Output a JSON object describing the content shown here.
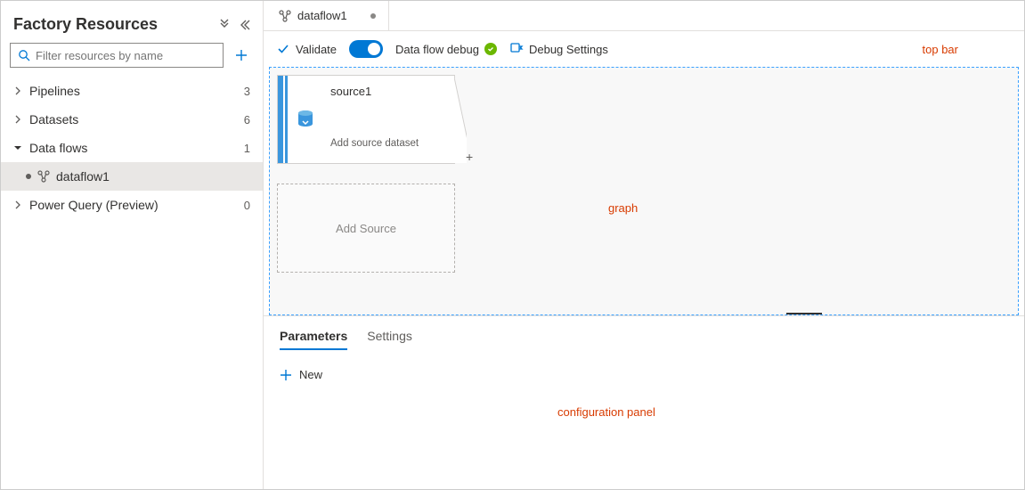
{
  "sidebar": {
    "title": "Factory Resources",
    "filter_placeholder": "Filter resources by name",
    "items": [
      {
        "label": "Pipelines",
        "count": "3",
        "expanded": false
      },
      {
        "label": "Datasets",
        "count": "6",
        "expanded": false
      },
      {
        "label": "Data flows",
        "count": "1",
        "expanded": true
      },
      {
        "label": "Power Query (Preview)",
        "count": "0",
        "expanded": false
      }
    ],
    "dataflow_child": "dataflow1"
  },
  "tab": {
    "label": "dataflow1"
  },
  "topbar": {
    "validate": "Validate",
    "debug_label": "Data flow debug",
    "debug_settings": "Debug Settings",
    "annotation": "top bar"
  },
  "graph": {
    "source_name": "source1",
    "source_hint": "Add source dataset",
    "add_source": "Add Source",
    "annotation": "graph"
  },
  "config": {
    "tabs": {
      "parameters": "Parameters",
      "settings": "Settings"
    },
    "new": "New",
    "annotation": "configuration panel"
  }
}
